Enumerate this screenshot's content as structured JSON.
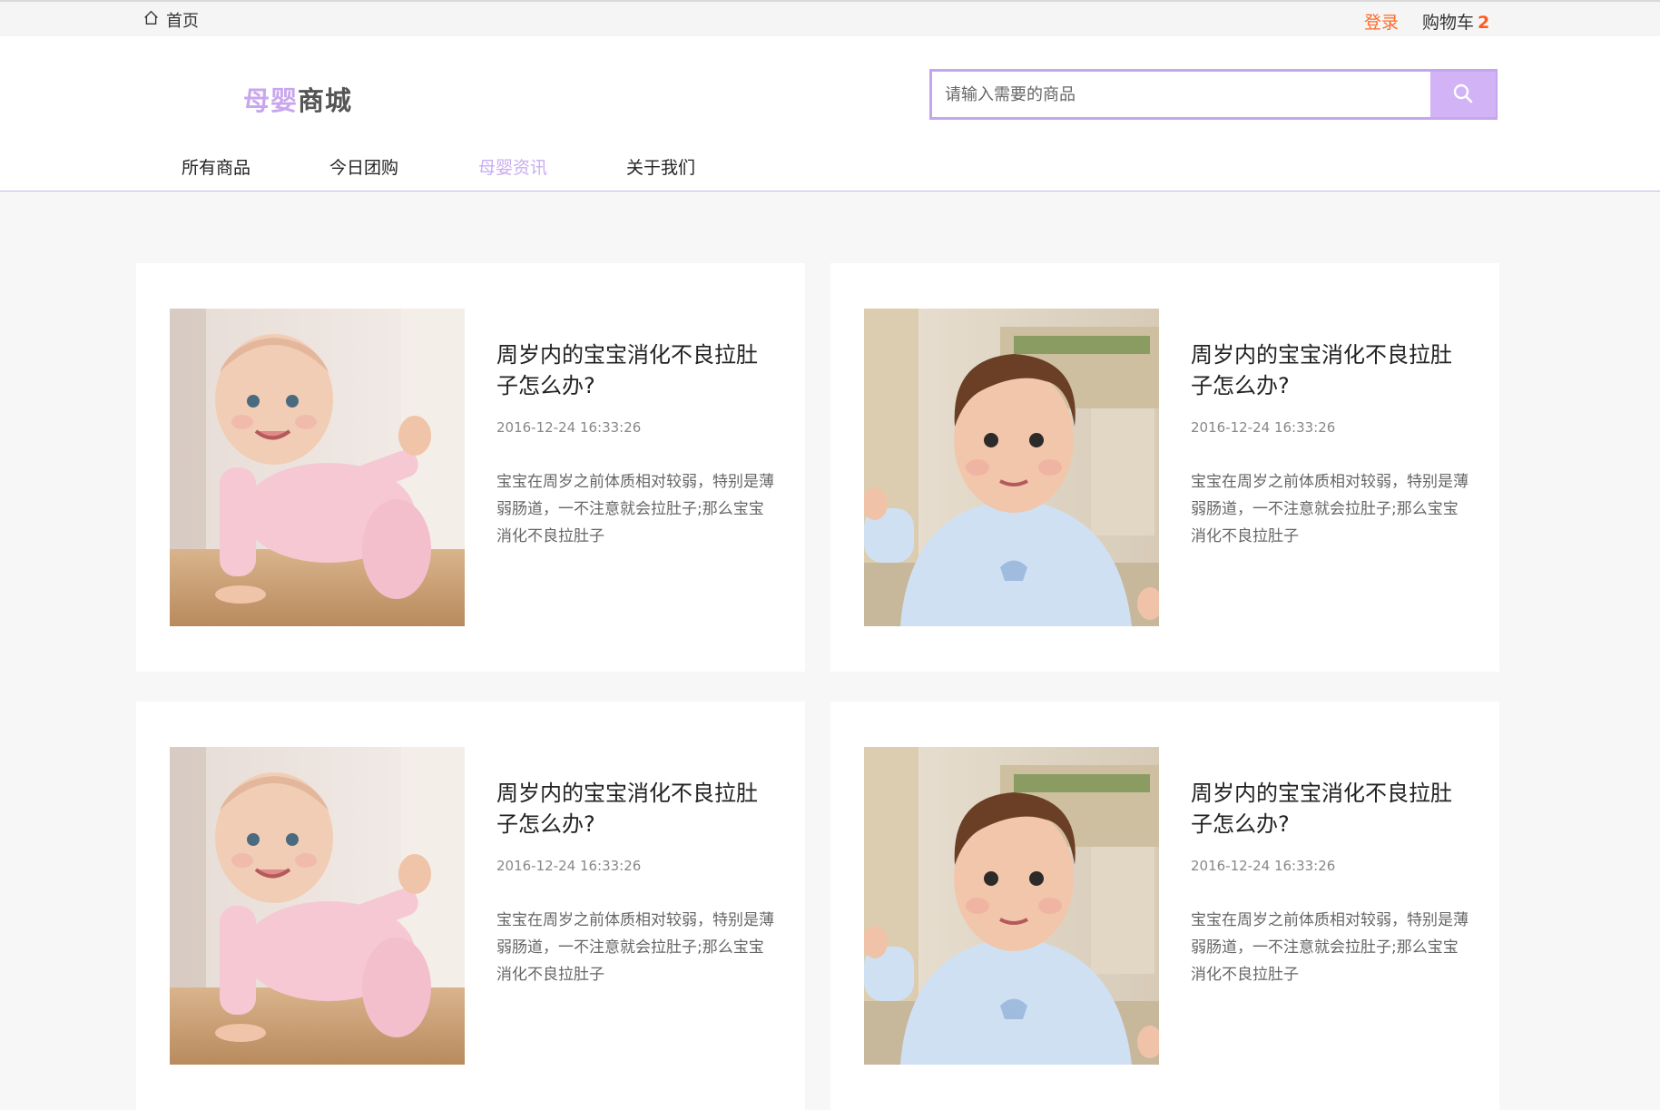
{
  "topbar": {
    "home_label": "首页",
    "login_label": "登录",
    "cart_label": "购物车",
    "cart_count": "2"
  },
  "header": {
    "logo_part1": "母婴",
    "logo_part2": "商城",
    "search_placeholder": "请输入需要的商品",
    "search_value": ""
  },
  "nav": {
    "items": [
      {
        "label": "所有商品"
      },
      {
        "label": "今日团购"
      },
      {
        "label": "母婴资讯",
        "active": true
      },
      {
        "label": "关于我们"
      }
    ]
  },
  "articles": [
    {
      "title": "周岁内的宝宝消化不良拉肚子怎么办?",
      "date": "2016-12-24 16:33:26",
      "summary": "宝宝在周岁之前体质相对较弱，特别是薄弱肠道，一不注意就会拉肚子;那么宝宝消化不良拉肚子",
      "image": "crawling-baby-pink-photo"
    },
    {
      "title": "周岁内的宝宝消化不良拉肚子怎么办?",
      "date": "2016-12-24 16:33:26",
      "summary": "宝宝在周岁之前体质相对较弱，特别是薄弱肠道，一不注意就会拉肚子;那么宝宝消化不良拉肚子",
      "image": "sitting-baby-blue-photo"
    },
    {
      "title": "周岁内的宝宝消化不良拉肚子怎么办?",
      "date": "2016-12-24 16:33:26",
      "summary": "宝宝在周岁之前体质相对较弱，特别是薄弱肠道，一不注意就会拉肚子;那么宝宝消化不良拉肚子",
      "image": "crawling-baby-pink-photo"
    },
    {
      "title": "周岁内的宝宝消化不良拉肚子怎么办?",
      "date": "2016-12-24 16:33:26",
      "summary": "宝宝在周岁之前体质相对较弱，特别是薄弱肠道，一不注意就会拉肚子;那么宝宝消化不良拉肚子",
      "image": "sitting-baby-blue-photo"
    }
  ],
  "colors": {
    "accent": "#c9aef0",
    "search_button": "#d2b4f6",
    "login": "#ff6a28",
    "cart_count": "#ff5a1f",
    "page_background": "#f7f7f7"
  }
}
